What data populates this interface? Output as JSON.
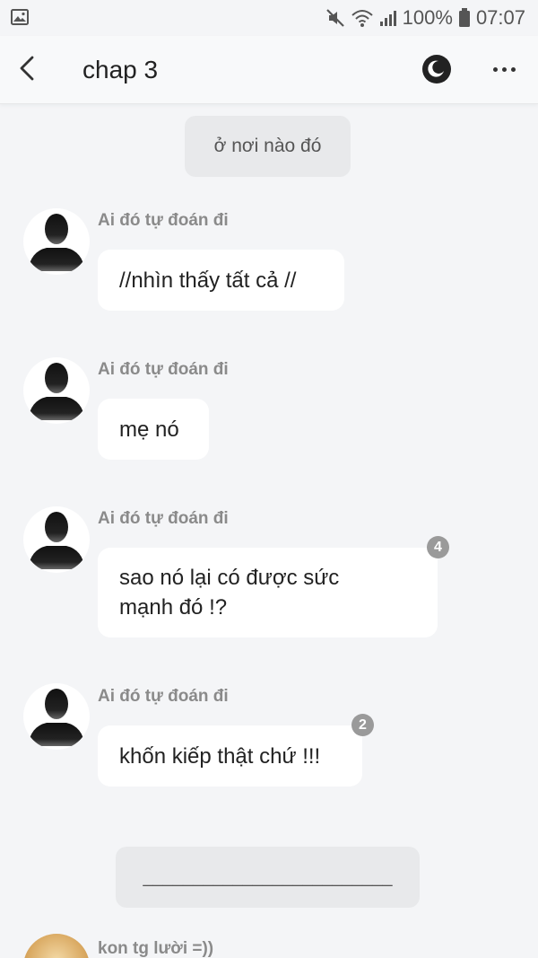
{
  "status_bar": {
    "battery": "100%",
    "time": "07:07",
    "icons": [
      "image-icon",
      "mute-icon",
      "wifi-icon",
      "signal-icon",
      "battery-icon"
    ]
  },
  "app_bar": {
    "title": "chap 3",
    "back_icon": "back-arrow-icon",
    "theme_icon": "night-mode-icon",
    "more_icon": "more-options-icon"
  },
  "location_note": "ở nơi nào đó",
  "messages": [
    {
      "sender": "Ai đó tự đoán đi",
      "text": "//nhìn thấy tất cả //",
      "badge": null
    },
    {
      "sender": "Ai đó tự đoán đi",
      "text": "mẹ nó",
      "badge": null
    },
    {
      "sender": "Ai đó tự đoán đi",
      "text": "sao nó lại có được sức mạnh đó !?",
      "badge": "4"
    },
    {
      "sender": "Ai đó tự đoán đi",
      "text": "khốn kiếp thật chứ !!!",
      "badge": "2"
    }
  ],
  "separator_text": "_________________________",
  "next_message": {
    "sender": "kon tg lười =))"
  },
  "colors": {
    "background": "#f4f5f7",
    "bubble": "#ffffff",
    "note": "#e8e9eb",
    "badge": "#9a9a9a"
  }
}
